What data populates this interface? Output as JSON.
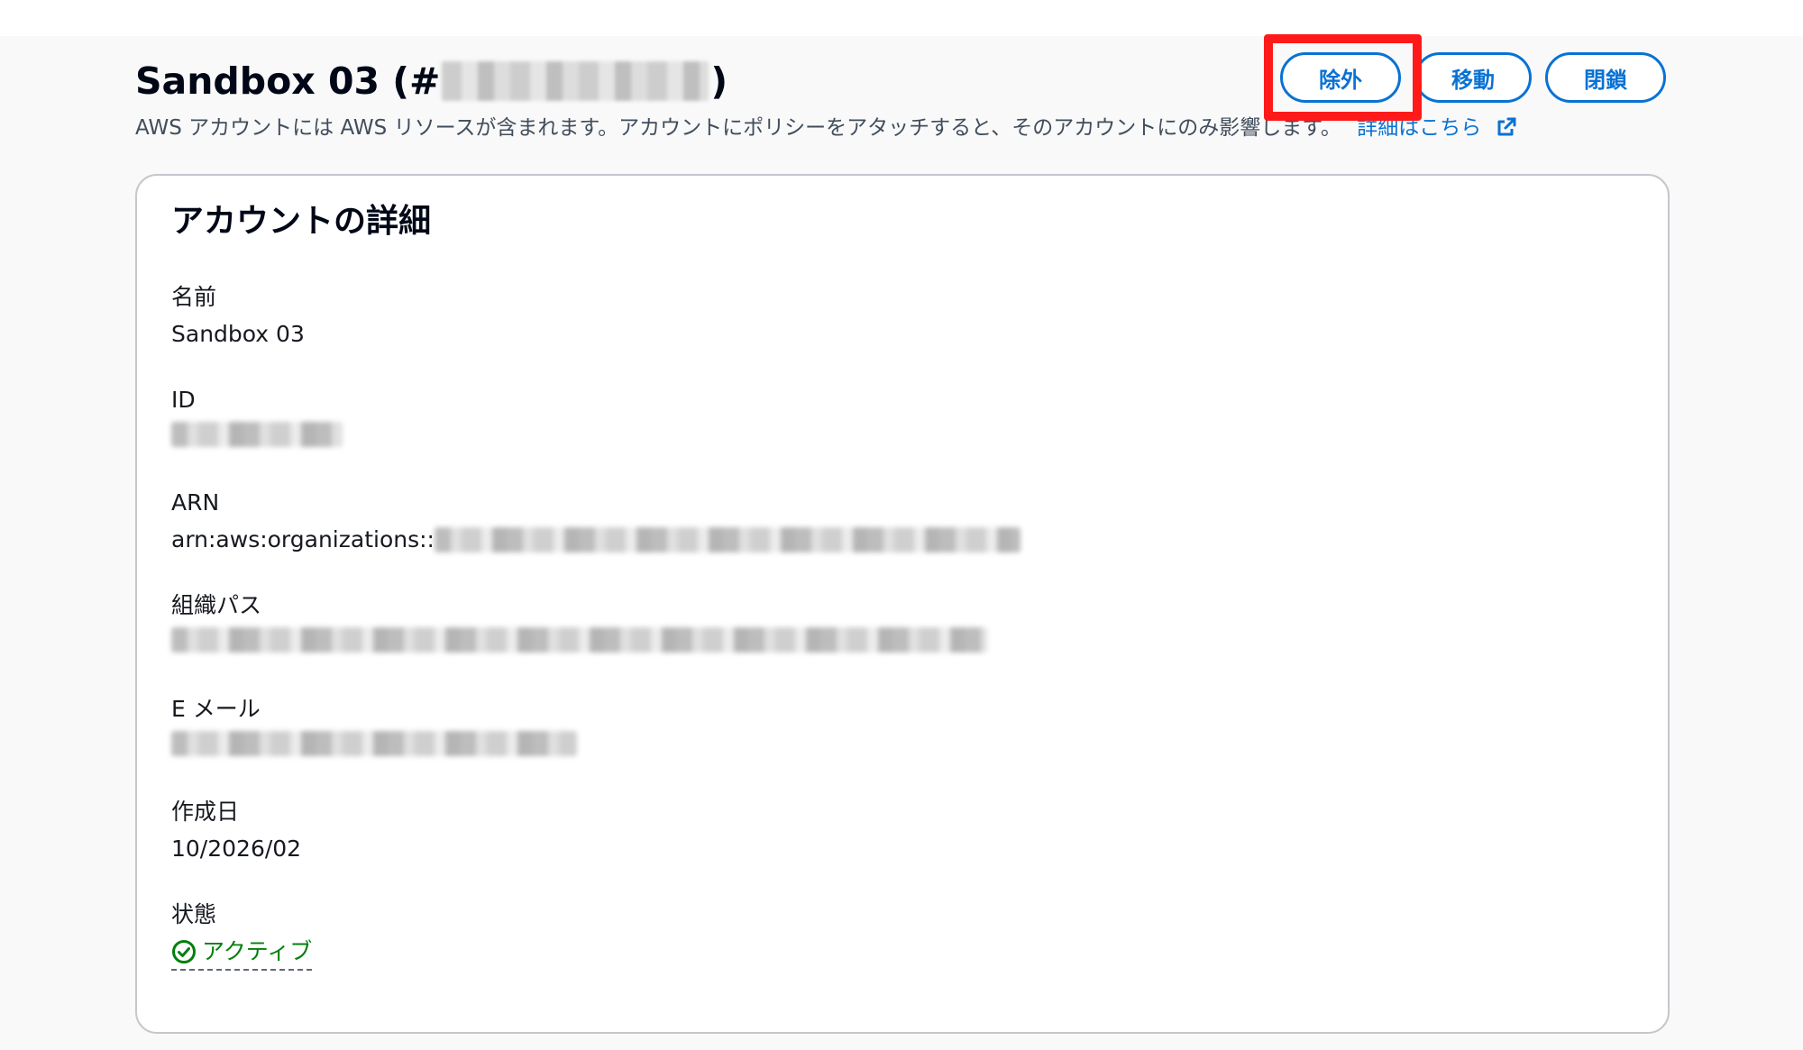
{
  "header": {
    "title_prefix": "Sandbox 03 (#",
    "title_suffix": ")",
    "description": "AWS アカウントには AWS リソースが含まれます。アカウントにポリシーをアタッチすると、そのアカウントにのみ影響します。",
    "learn_more_link": "詳細はこちら"
  },
  "actions": {
    "exclude_label": "除外",
    "move_label": "移動",
    "close_label": "閉鎖"
  },
  "card": {
    "title": "アカウントの詳細",
    "fields": {
      "name": {
        "label": "名前",
        "value": "Sandbox 03"
      },
      "id": {
        "label": "ID"
      },
      "arn": {
        "label": "ARN",
        "value_prefix": "arn:aws:organizations::"
      },
      "path": {
        "label": "組織パス"
      },
      "email": {
        "label": "E メール"
      },
      "created": {
        "label": "作成日",
        "value": "10/2026/02"
      },
      "state": {
        "label": "状態",
        "value": "アクティブ"
      }
    }
  },
  "colors": {
    "link": "#0972d3",
    "success": "#037f0c",
    "highlight": "#ff1a1a"
  },
  "icons": {
    "external_link": "external-link-icon",
    "status_ok": "check-circle-icon"
  }
}
